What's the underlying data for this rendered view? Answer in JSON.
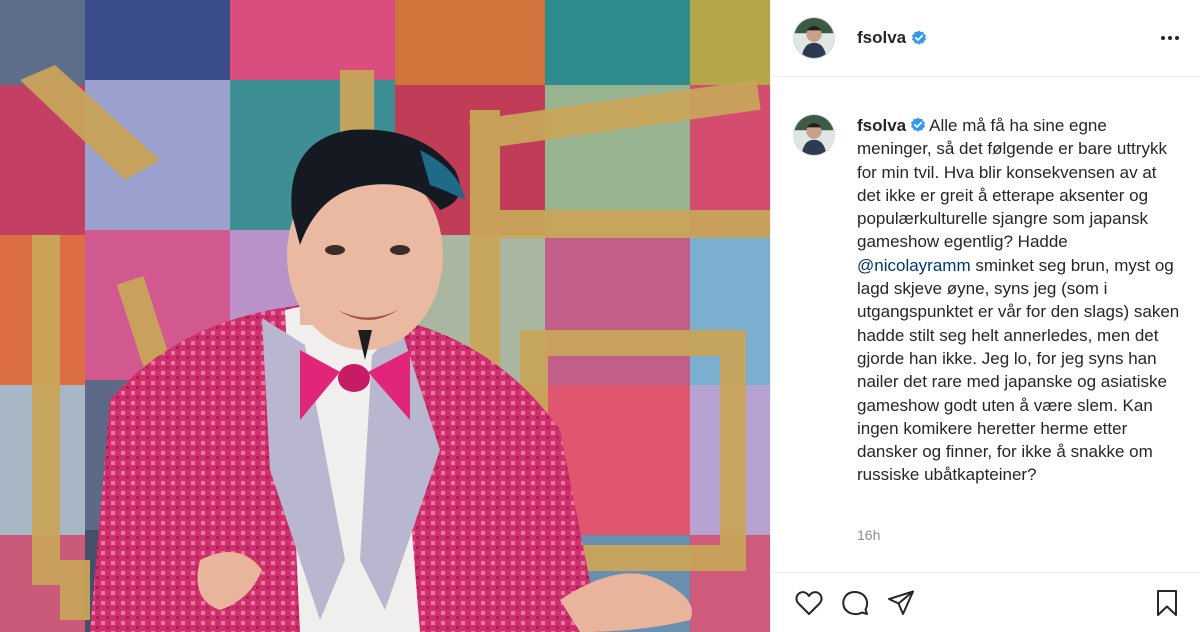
{
  "post": {
    "username": "fsolva",
    "verified": true,
    "caption": {
      "username": "fsolva",
      "text_before_mention": "Alle må få ha sine egne meninger, så det følgende er bare uttrykk for min tvil. Hva blir konsekvensen av at det ikke er greit å etterape aksenter og populærkulturelle sjangre som japansk gameshow egentlig? Hadde ",
      "mention": "@nicolayramm",
      "text_after_mention": " sminket seg brun, myst og lagd skjeve øyne, syns jeg (som i utgangspunktet er vår for den slags) saken hadde stilt seg helt annerledes, men det gjorde han ikke. Jeg lo, for jeg syns han nailer det rare med japanske og asiatiske gameshow godt uten å være slem. Kan ingen komikere heretter herme etter dansker og finner, for ikke å snakke om russiske ubåtkapteiner?"
    },
    "timestamp": "16h"
  },
  "icons": {
    "more": "more-options-icon",
    "verified": "verified-badge-icon",
    "like": "heart-icon",
    "comment": "comment-icon",
    "share": "paper-plane-icon",
    "save": "bookmark-icon"
  },
  "colors": {
    "verified_blue": "#3897f0",
    "mention": "#00376b",
    "muted": "#8e8e8e",
    "jacket_pink": "#d7326e"
  }
}
